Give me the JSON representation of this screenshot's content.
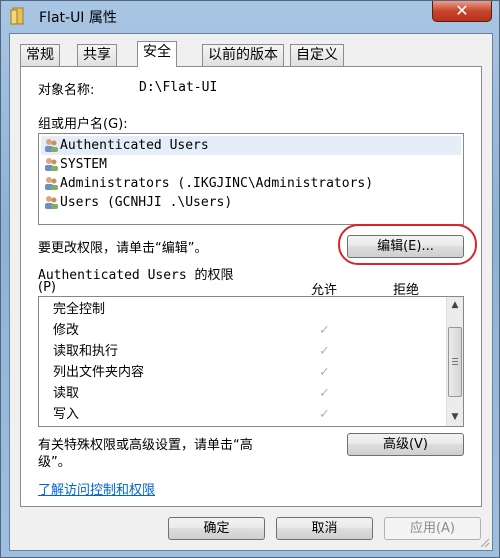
{
  "window": {
    "title": "Flat-UI 属性",
    "close_glyph": "✕"
  },
  "tabs": [
    {
      "label": "常规",
      "active": false
    },
    {
      "label": "共享",
      "active": false
    },
    {
      "label": "安全",
      "active": true
    },
    {
      "label": "以前的版本",
      "active": false
    },
    {
      "label": "自定义",
      "active": false
    }
  ],
  "security": {
    "object_name_label": "对象名称:",
    "object_name_value": "D:\\Flat-UI",
    "groups_label": "组或用户名(G):",
    "users": [
      {
        "name": "Authenticated Users",
        "icon": "users-icon",
        "selected": true
      },
      {
        "name": "SYSTEM",
        "icon": "users-icon",
        "selected": false
      },
      {
        "name": "Administrators (.IKGJINC\\Administrators)",
        "icon": "users-icon",
        "selected": false
      },
      {
        "name": "Users (GCNHJI  .\\Users)",
        "icon": "users-icon",
        "selected": false
      }
    ],
    "change_hint": "要更改权限，请单击“编辑”。",
    "edit_button": "编辑(E)...",
    "permissions_for_line1": "Authenticated Users 的权限",
    "permissions_for_line2": "(P)",
    "allow_header": "允许",
    "deny_header": "拒绝",
    "permissions": [
      {
        "name": "完全控制",
        "allow": false,
        "deny": false
      },
      {
        "name": "修改",
        "allow": true,
        "deny": false
      },
      {
        "name": "读取和执行",
        "allow": true,
        "deny": false
      },
      {
        "name": "列出文件夹内容",
        "allow": true,
        "deny": false
      },
      {
        "name": "读取",
        "allow": true,
        "deny": false
      },
      {
        "name": "写入",
        "allow": true,
        "deny": false
      }
    ],
    "check_glyph": "✓",
    "advanced_hint_line1": "有关特殊权限或高级设置，请单击“高",
    "advanced_hint_line2": "级”。",
    "advanced_button": "高级(V)",
    "learn_link": "了解访问控制和权限"
  },
  "footer": {
    "ok_button": "确定",
    "cancel_button": "取消",
    "apply_button": "应用(A)"
  },
  "colors": {
    "highlight_oval": "#d9262b",
    "link": "#0066cc"
  }
}
